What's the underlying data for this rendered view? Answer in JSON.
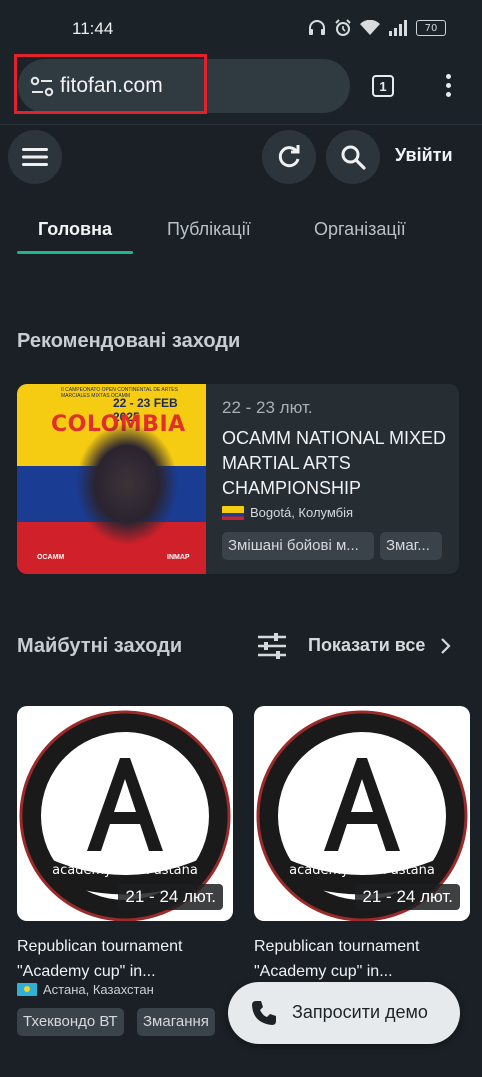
{
  "status_bar": {
    "time": "11:44",
    "battery": "70"
  },
  "browser": {
    "url": "fitofan.com",
    "tab_count": "1"
  },
  "header": {
    "login_label": "Увійти"
  },
  "tabs": [
    {
      "label": "Головна",
      "active": true
    },
    {
      "label": "Публікації",
      "active": false
    },
    {
      "label": "Організації",
      "active": false
    }
  ],
  "featured": {
    "section_title": "Рекомендовані заходи",
    "poster": {
      "subtitle": "II CAMPEONATO OPEN CONTINENTAL DE ARTES MARCIALES MIXTAS OCAMM",
      "dates": "22 - 23 FEB 2025",
      "country": "COLOMBIA",
      "brand_left": "OCAMM",
      "brand_right": "INMAP"
    },
    "date": "22 - 23 лют.",
    "title": "OCAMM NATIONAL MIXED MARTIAL ARTS CHAMPIONSHIP",
    "location": "Bogotá, Колумбія",
    "tags": [
      "Змішані бойові м...",
      "Змаг..."
    ]
  },
  "upcoming": {
    "section_title": "Майбутні заходи",
    "show_all_label": "Показати все",
    "events": [
      {
        "logo_letter": "A",
        "logo_text": "academy team astana",
        "date": "21 - 24 лют.",
        "title": "Republican tournament \"Academy cup\" in...",
        "location": "Астана, Казахстан",
        "tags": [
          "Тхеквондо ВТ",
          "Змагання"
        ]
      },
      {
        "logo_letter": "A",
        "logo_text": "academy team astana",
        "date": "21 - 24 лют.",
        "title": "Republican tournament \"Academy cup\" in...",
        "location": "",
        "tags": []
      }
    ]
  },
  "fab": {
    "label": "Запросити демо"
  }
}
